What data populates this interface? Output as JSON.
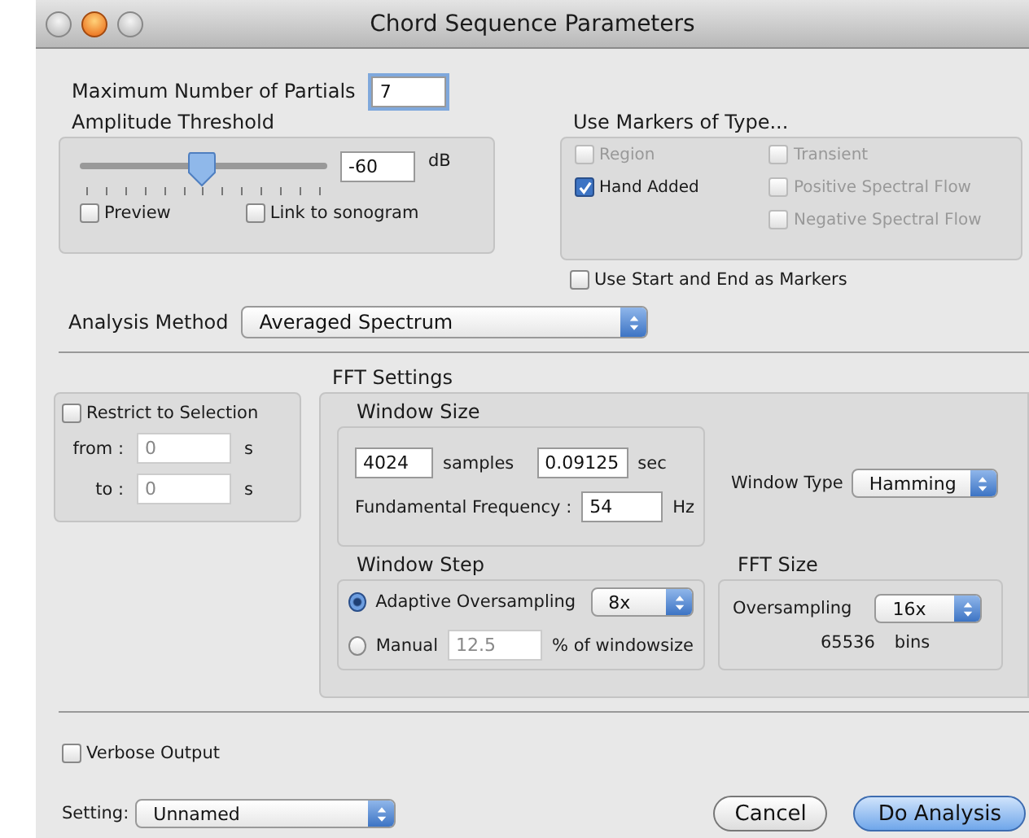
{
  "window": {
    "title": "Chord Sequence Parameters"
  },
  "max_partials": {
    "label": "Maximum Number of Partials",
    "value": "7"
  },
  "amplitude_threshold": {
    "title": "Amplitude Threshold",
    "level": 0.5,
    "value": "-60",
    "unit": "dB",
    "checkboxes": [
      {
        "label": "Preview",
        "checked": false
      },
      {
        "label": "Link to sonogram",
        "checked": false
      }
    ]
  },
  "markers": {
    "title": "Use Markers of Type...",
    "columns": [
      [
        {
          "label": "Region",
          "checked": false,
          "disabled": true
        },
        {
          "label": "Hand Added",
          "checked": true,
          "disabled": false
        }
      ],
      [
        {
          "label": "Transient",
          "checked": false,
          "disabled": true
        },
        {
          "label": "Positive Spectral Flow",
          "checked": false,
          "disabled": true
        },
        {
          "label": "Negative Spectral Flow",
          "checked": false,
          "disabled": true
        }
      ]
    ]
  },
  "use_start_end": {
    "label": "Use Start and End as Markers",
    "checked": false
  },
  "analysis_method": {
    "label": "Analysis Method",
    "value": "Averaged Spectrum"
  },
  "restrict": {
    "label": "Restrict to Selection",
    "checked": false,
    "fields": [
      {
        "label": "from :",
        "value": "0",
        "unit": "s"
      },
      {
        "label": "to :",
        "value": "0",
        "unit": "s"
      }
    ]
  },
  "fft_settings": {
    "title": "FFT Settings",
    "window_size": {
      "title": "Window Size",
      "samples": {
        "value": "4024",
        "unit": "samples"
      },
      "seconds": {
        "value": "0.09125",
        "unit": "sec"
      },
      "fundamental": {
        "label": "Fundamental Frequency :",
        "value": "54",
        "unit": "Hz"
      }
    },
    "window_type": {
      "label": "Window Type",
      "value": "Hamming"
    },
    "window_step": {
      "title": "Window Step",
      "options": [
        {
          "label": "Adaptive Oversampling",
          "selected": true,
          "kind": "select",
          "value": "8x"
        },
        {
          "label": "Manual",
          "selected": false,
          "kind": "field",
          "value": "12.5",
          "unit": "% of windowsize"
        }
      ]
    },
    "fft_size": {
      "title": "FFT Size",
      "label": "Oversampling",
      "value": "16x",
      "bins": "65536",
      "bins_unit": "bins"
    }
  },
  "verbose": {
    "label": "Verbose Output",
    "checked": false
  },
  "setting": {
    "label": "Setting:",
    "value": "Unnamed"
  },
  "buttons": [
    {
      "label": "Cancel",
      "default": false
    },
    {
      "label": "Do Analysis",
      "default": true
    }
  ]
}
